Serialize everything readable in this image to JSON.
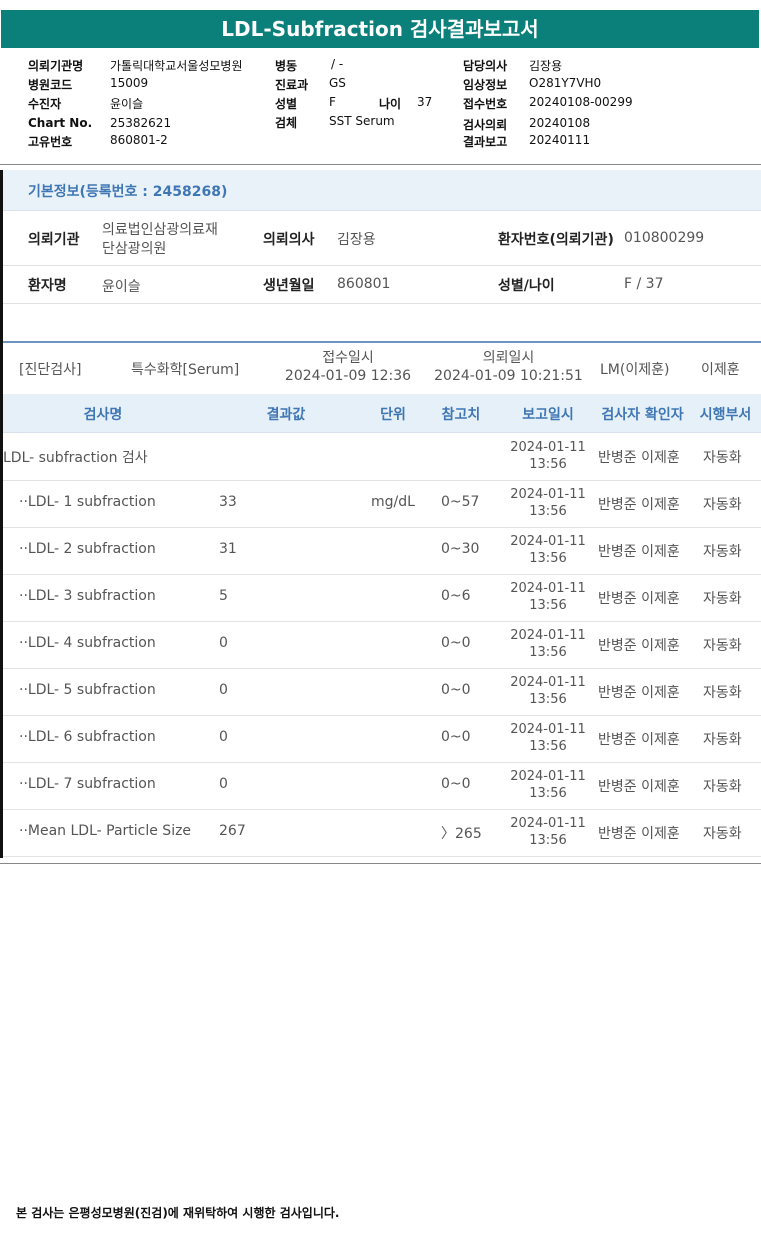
{
  "title": "LDL-Subfraction 검사결과보고서",
  "meta": {
    "left": [
      {
        "label": "의뢰기관명",
        "value": "가톨릭대학교서울성모병원"
      },
      {
        "label": "병원코드",
        "value": "15009"
      },
      {
        "label": "수진자",
        "value": "윤이슬"
      },
      {
        "label": "Chart No.",
        "value": "25382621"
      },
      {
        "label": "고유번호",
        "value": "860801-2"
      }
    ],
    "mid": {
      "ward_label": "병동",
      "ward_value": "/ -",
      "dept_label": "진료과",
      "dept_value": "GS",
      "sex_label": "성별",
      "sex_value": "F",
      "age_label": "나이",
      "age_value": "37",
      "specimen_label": "검체",
      "specimen_value": "SST Serum"
    },
    "right": [
      {
        "label": "담당의사",
        "value": "김장용"
      },
      {
        "label": "임상정보",
        "value": "O281Y7VH0"
      },
      {
        "label": "접수번호",
        "value": "20240108-00299"
      },
      {
        "label": "검사의뢰",
        "value": "20240108"
      },
      {
        "label": "결과보고",
        "value": "20240111"
      }
    ]
  },
  "basic": {
    "header": "기본정보(등록번호 : 2458268)",
    "row1": {
      "inst_label": "의뢰기관",
      "inst_value_1": "의료법인삼광의료재",
      "inst_value_2": "단삼광의원",
      "doctor_label": "의뢰의사",
      "doctor_value": "김장용",
      "pid_label": "환자번호(의뢰기관)",
      "pid_value": "010800299"
    },
    "row2": {
      "name_label": "환자명",
      "name_value": "윤이슬",
      "dob_label": "생년월일",
      "dob_value": "860801",
      "sexage_label": "성별/나이",
      "sexage_value": "F / 37"
    }
  },
  "diag": {
    "category": "[진단검사]",
    "sample": "특수화학[Serum]",
    "received_label": "접수일시",
    "received_value": "2024-01-09 12:36",
    "requested_label": "의뢰일시",
    "requested_value": "2024-01-09 10:21:51",
    "lab": "LM(이제훈)",
    "confirmer": "이제훈"
  },
  "table": {
    "headers": {
      "name": "검사명",
      "result": "결과값",
      "unit": "단위",
      "ref": "참고치",
      "report": "보고일시",
      "checker": "검사자 확인자",
      "dept": "시행부서"
    },
    "rows": [
      {
        "name": "LDL- subfraction 검사",
        "result": "",
        "unit": "",
        "ref": "",
        "date": "2024-01-11",
        "time": "13:56",
        "checker": "반병준 이제훈",
        "dept": "자동화",
        "indent": false
      },
      {
        "name": "··LDL- 1 subfraction",
        "result": "33",
        "unit": "mg/dL",
        "ref": "0~57",
        "date": "2024-01-11",
        "time": "13:56",
        "checker": "반병준 이제훈",
        "dept": "자동화",
        "indent": true
      },
      {
        "name": "··LDL- 2 subfraction",
        "result": "31",
        "unit": "",
        "ref": "0~30",
        "date": "2024-01-11",
        "time": "13:56",
        "checker": "반병준 이제훈",
        "dept": "자동화",
        "indent": true
      },
      {
        "name": "··LDL- 3 subfraction",
        "result": "5",
        "unit": "",
        "ref": "0~6",
        "date": "2024-01-11",
        "time": "13:56",
        "checker": "반병준 이제훈",
        "dept": "자동화",
        "indent": true
      },
      {
        "name": "··LDL- 4 subfraction",
        "result": "0",
        "unit": "",
        "ref": "0~0",
        "date": "2024-01-11",
        "time": "13:56",
        "checker": "반병준 이제훈",
        "dept": "자동화",
        "indent": true
      },
      {
        "name": "··LDL- 5 subfraction",
        "result": "0",
        "unit": "",
        "ref": "0~0",
        "date": "2024-01-11",
        "time": "13:56",
        "checker": "반병준 이제훈",
        "dept": "자동화",
        "indent": true
      },
      {
        "name": "··LDL- 6 subfraction",
        "result": "0",
        "unit": "",
        "ref": "0~0",
        "date": "2024-01-11",
        "time": "13:56",
        "checker": "반병준 이제훈",
        "dept": "자동화",
        "indent": true
      },
      {
        "name": "··LDL- 7 subfraction",
        "result": "0",
        "unit": "",
        "ref": "0~0",
        "date": "2024-01-11",
        "time": "13:56",
        "checker": "반병준 이제훈",
        "dept": "자동화",
        "indent": true
      },
      {
        "name": "··Mean LDL- Particle Size",
        "result": "267",
        "unit": "",
        "ref": "〉265",
        "date": "2024-01-11",
        "time": "13:56",
        "checker": "반병준 이제훈",
        "dept": "자동화",
        "indent": true
      }
    ]
  },
  "footer": "본 검사는 은평성모병원(진검)에 재위탁하여 시행한 검사입니다."
}
